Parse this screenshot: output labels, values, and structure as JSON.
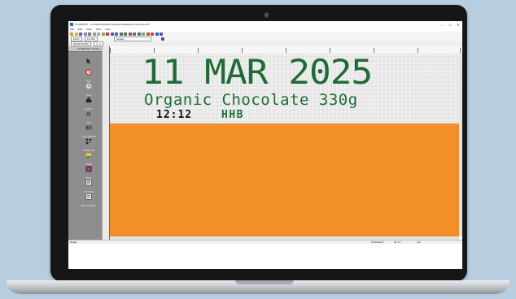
{
  "window": {
    "title": "CLARiSOFT - C:\\ClarisOft\\Data\\ChocDemoDatabase\\3 100.cmpx.cff*",
    "minimize": "–",
    "maximize": "☐",
    "close": "✕"
  },
  "menu": [
    "File",
    "Edit",
    "View",
    "Tools",
    "Help"
  ],
  "fields": {
    "zoom": "100%",
    "size": "1/2.000",
    "field_type": "Garage",
    "nav_value": "80001/110000",
    "page_value": "1 / 1"
  },
  "toolbox": {
    "header": "CLARiSOFT Toolbox",
    "tools": [
      {
        "label": "",
        "icon": "pointer-icon"
      },
      {
        "label": "Date",
        "icon": "clock-icon"
      },
      {
        "label": "Time",
        "icon": "time-icon"
      },
      {
        "label": "Counter",
        "icon": "counter-icon"
      },
      {
        "label": "Text",
        "icon": "text-icon"
      },
      {
        "label": "Linear Barcode",
        "icon": "linear-barcode-icon"
      },
      {
        "label": "2D Barcode",
        "icon": "2d-barcode-icon"
      },
      {
        "label": "Image",
        "icon": "image-icon"
      },
      {
        "label": "Shape",
        "icon": "shape-icon"
      },
      {
        "label": "Text Block",
        "icon": "text-block-icon"
      },
      {
        "label": "Rich Text Block",
        "icon": "rich-text-icon"
      }
    ]
  },
  "label_content": {
    "date": "11 MAR 2025",
    "product": "Organic Chocolate 330g",
    "time": "12:12",
    "code": "HHB"
  },
  "colors": {
    "print_green": "#1f6b35",
    "product_area": "#f28f28",
    "toolbox_bg": "#8d8d8d"
  },
  "status": {
    "left": "Ready",
    "printhead": "Printhead: 1",
    "position": "30, 17",
    "mode": "mm"
  }
}
